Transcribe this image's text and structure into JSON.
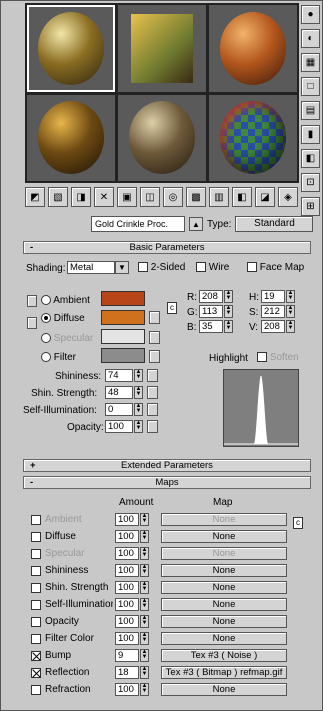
{
  "slots": [
    {
      "name": "gold-crinkle-sphere",
      "colors": [
        "#f2e6a8",
        "#8a6d22",
        "#2c2410"
      ]
    },
    {
      "name": "tiled-cube",
      "colors": [
        "#e9c24e",
        "#6f7a30",
        "#3a2a12"
      ]
    },
    {
      "name": "rust-sphere",
      "colors": [
        "#f1b36a",
        "#b4571e",
        "#3b1708"
      ]
    },
    {
      "name": "crosshatch-sphere",
      "colors": [
        "#e8b64a",
        "#6e4a12",
        "#1c1206"
      ]
    },
    {
      "name": "wood-bark-sphere",
      "colors": [
        "#ddd0a8",
        "#6e5a3a",
        "#24190e"
      ]
    },
    {
      "name": "checker-sphere",
      "colors": [
        "#3f8a3a",
        "#2a4fa8",
        "#c23a2a"
      ]
    }
  ],
  "sidebar_icons": [
    "sphere-type-icon",
    "backlight-icon",
    "checker-background-icon",
    "sample-uv-icon",
    "video-color-check-icon",
    "make-preview-icon",
    "options-icon",
    "select-by-material-icon",
    "material-navigator-icon"
  ],
  "toolbar_icons": [
    "get-material-icon",
    "put-to-scene-icon",
    "assign-to-selection-icon",
    "reset-map-icon",
    "make-copy-icon",
    "put-to-library-icon",
    "material-effects-channel-icon",
    "show-map-in-viewport-icon",
    "show-end-result-icon",
    "go-to-parent-icon",
    "go-forward-to-sibling-icon",
    "pick-material-icon"
  ],
  "material": {
    "name": "Gold Crinkle Proc.",
    "type_label": "Type:",
    "type_value": "Standard"
  },
  "basic": {
    "header": "Basic Parameters",
    "shading_label": "Shading:",
    "shading_value": "Metal",
    "two_sided": "2-Sided",
    "wire": "Wire",
    "face_map": "Face Map",
    "ambient": "Ambient",
    "diffuse": "Diffuse",
    "specular": "Specular",
    "filter": "Filter",
    "colors": {
      "ambient": "#b8441a",
      "diffuse": "#d0711d",
      "specular": "#e4e4e4",
      "filter": "#8c8c8c"
    },
    "rgb": {
      "r_label": "R:",
      "r": "208",
      "g_label": "G:",
      "g": "113",
      "b_label": "B:",
      "b": "35"
    },
    "hsv": {
      "h_label": "H:",
      "h": "19",
      "s_label": "S:",
      "s": "212",
      "v_label": "V:",
      "v": "208"
    },
    "highlight": "Highlight",
    "soften": "Soften",
    "shininess_label": "Shininess:",
    "shininess": "74",
    "shin_strength_label": "Shin. Strength:",
    "shin_strength": "48",
    "self_illum_label": "Self-Illumination:",
    "self_illum": "0",
    "opacity_label": "Opacity:",
    "opacity": "100",
    "lock_icon": "lock-icon"
  },
  "extended": {
    "header": "Extended Parameters"
  },
  "maps": {
    "header": "Maps",
    "col_amount": "Amount",
    "col_map": "Map",
    "rows": [
      {
        "label": "Ambient",
        "amount": "100",
        "map": "None",
        "checked": false,
        "enabled": false
      },
      {
        "label": "Diffuse",
        "amount": "100",
        "map": "None",
        "checked": false,
        "enabled": true
      },
      {
        "label": "Specular",
        "amount": "100",
        "map": "None",
        "checked": false,
        "enabled": false
      },
      {
        "label": "Shininess",
        "amount": "100",
        "map": "None",
        "checked": false,
        "enabled": true
      },
      {
        "label": "Shin. Strength",
        "amount": "100",
        "map": "None",
        "checked": false,
        "enabled": true
      },
      {
        "label": "Self-Illumination",
        "amount": "100",
        "map": "None",
        "checked": false,
        "enabled": true
      },
      {
        "label": "Opacity",
        "amount": "100",
        "map": "None",
        "checked": false,
        "enabled": true
      },
      {
        "label": "Filter Color",
        "amount": "100",
        "map": "None",
        "checked": false,
        "enabled": true
      },
      {
        "label": "Bump",
        "amount": "9",
        "map": "Tex #3 ( Noise )",
        "checked": true,
        "enabled": true
      },
      {
        "label": "Reflection",
        "amount": "18",
        "map": "Tex #3 ( Bitmap ) refmap.gif",
        "checked": true,
        "enabled": true
      },
      {
        "label": "Refraction",
        "amount": "100",
        "map": "None",
        "checked": false,
        "enabled": true
      }
    ]
  }
}
